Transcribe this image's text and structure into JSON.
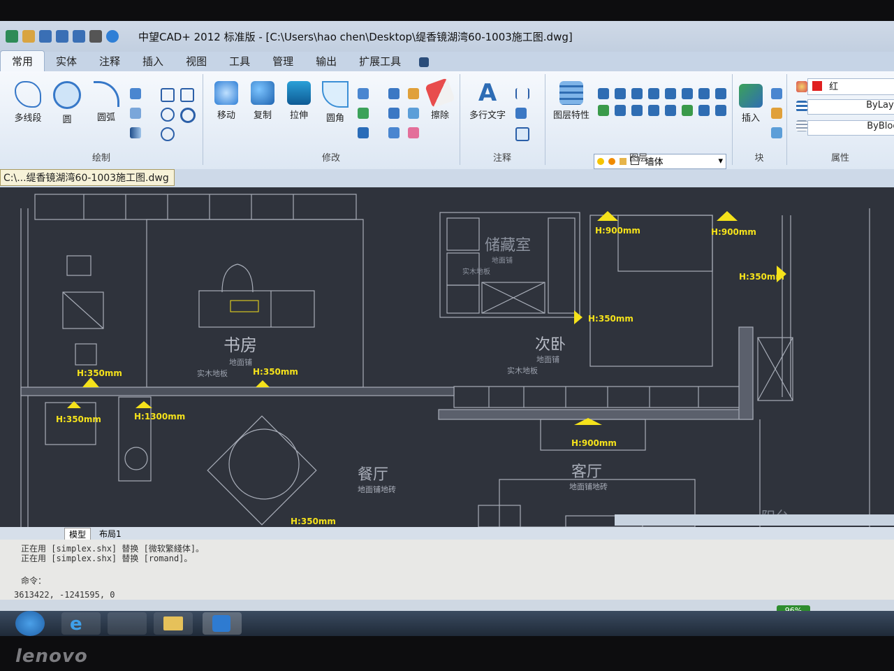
{
  "window": {
    "title": "中望CAD+ 2012 标准版 - [C:\\Users\\hao chen\\Desktop\\缇香镜湖湾60-1003施工图.dwg]"
  },
  "tabs": [
    "常用",
    "实体",
    "注释",
    "插入",
    "视图",
    "工具",
    "管理",
    "输出",
    "扩展工具"
  ],
  "ribbon": {
    "draw": {
      "label": "绘制",
      "buttons": [
        "多线段",
        "圆",
        "圆弧"
      ]
    },
    "modify": {
      "label": "修改",
      "buttons": [
        "移动",
        "复制",
        "拉伸",
        "圆角",
        "擦除"
      ]
    },
    "annotation": {
      "label": "注释",
      "buttons": [
        "多行文字"
      ]
    },
    "layers": {
      "label": "图层",
      "buttons": [
        "图层特性"
      ],
      "current_layer": "墙体"
    },
    "block": {
      "label": "块",
      "buttons": [
        "插入"
      ]
    },
    "properties": {
      "label": "属性",
      "color": "红",
      "linetype": "ByLayer",
      "lineweight": "ByBlock"
    }
  },
  "document_tab": "C:\\...缇香镜湖湾60-1003施工图.dwg",
  "drawing": {
    "rooms": [
      {
        "name": "书房",
        "sub1": "地面铺",
        "sub2": "实木地板"
      },
      {
        "name": "储藏室",
        "sub1": "地面铺",
        "sub2": "实木地板"
      },
      {
        "name": "次卧",
        "sub1": "地面铺",
        "sub2": "实木地板"
      },
      {
        "name": "餐厅",
        "sub1": "地面铺地砖"
      },
      {
        "name": "客厅",
        "sub1": "地面铺地砖"
      },
      {
        "name": "阳台"
      }
    ],
    "heights": [
      "H:900mm",
      "H:900mm",
      "H:350mm",
      "H:350mm",
      "H:350mm",
      "H:350mm",
      "H:350mm",
      "H:1300mm",
      "H:900mm",
      "H:350mm"
    ]
  },
  "layout_tabs": [
    "模型",
    "布局1"
  ],
  "command": {
    "line1": "正在用 [simplex.shx] 替换 [微软繁綫体]。",
    "line2": "正在用 [simplex.shx] 替换 [romand]。",
    "prompt": "命令："
  },
  "status": {
    "coords": "3613422, -1241595, 0",
    "battery": "96%"
  },
  "brand": "lenovo"
}
